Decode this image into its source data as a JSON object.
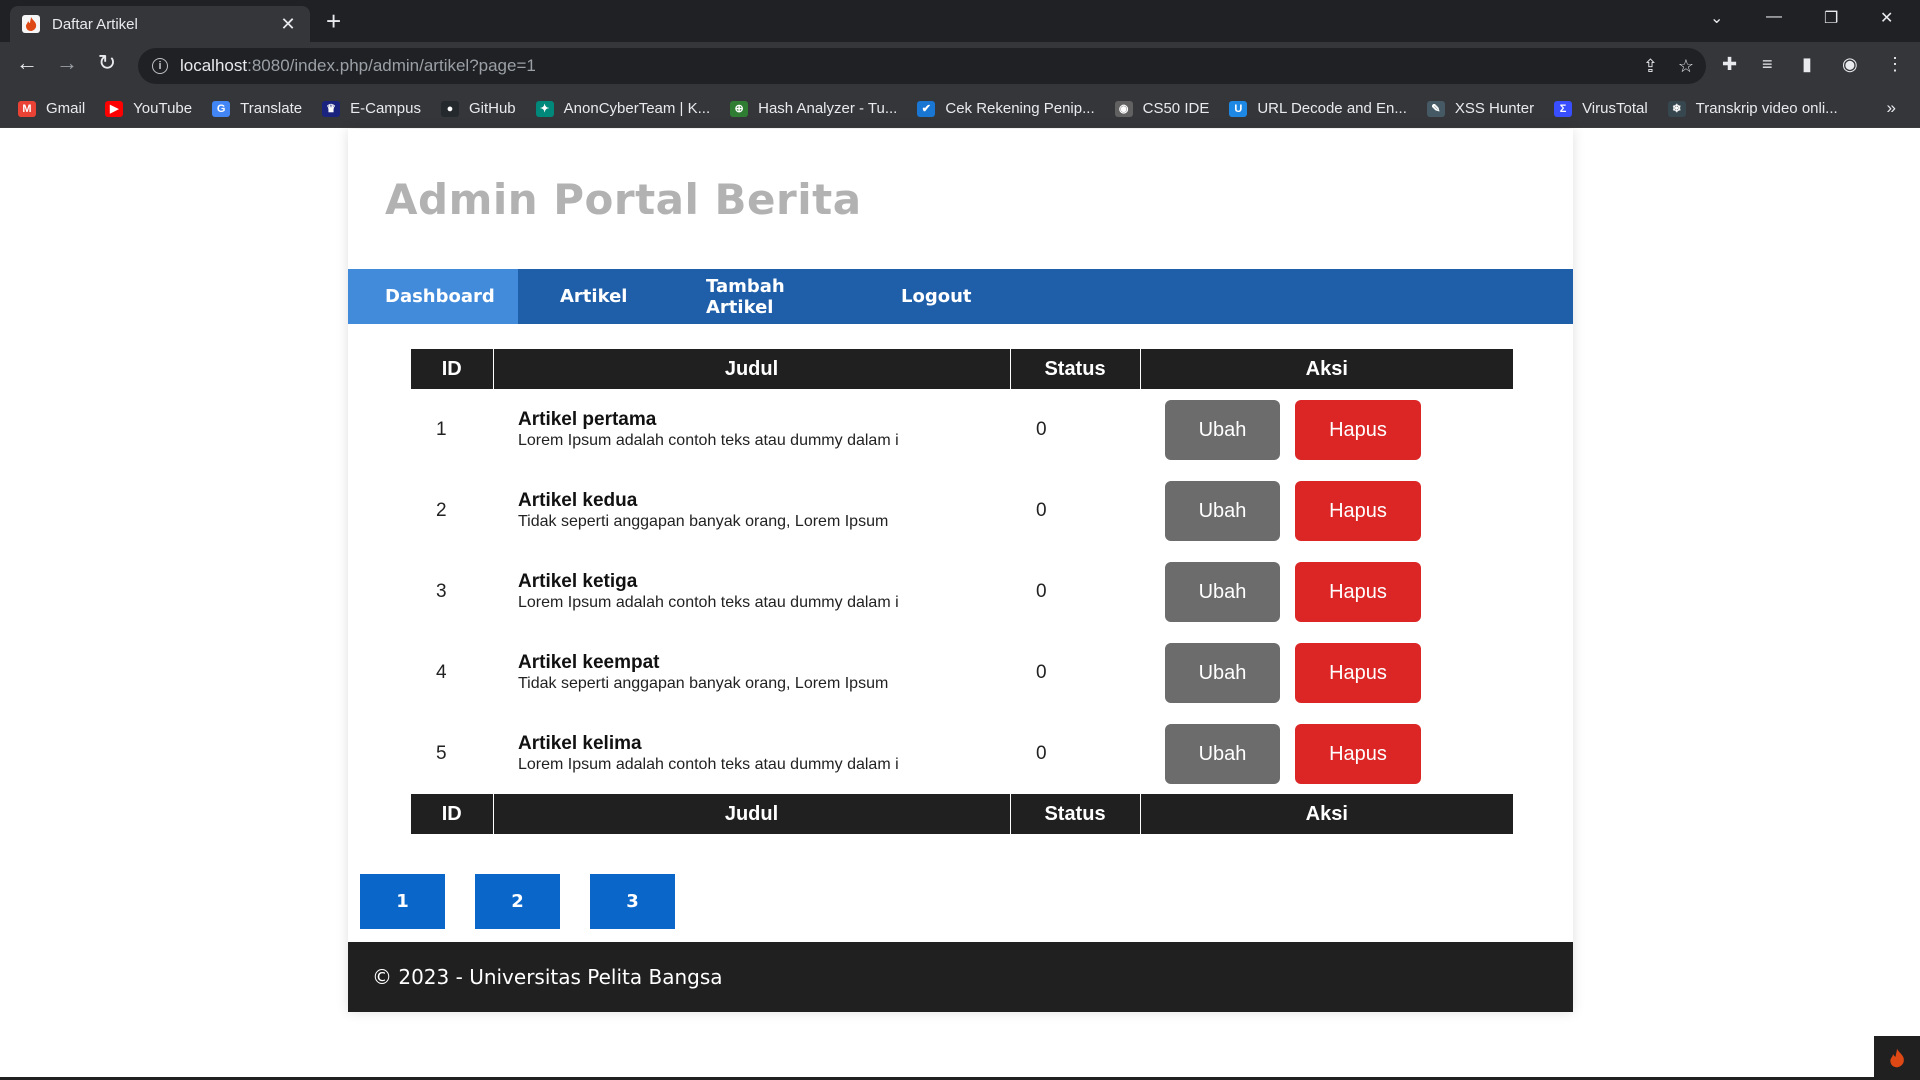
{
  "browser": {
    "tab_title": "Daftar Artikel",
    "url_host": "localhost",
    "url_rest": ":8080/index.php/admin/artikel?page=1",
    "bookmarks": [
      {
        "label": "Gmail",
        "icon": "gmail-icon",
        "color": "#ea4335",
        "glyph": "M"
      },
      {
        "label": "YouTube",
        "icon": "youtube-icon",
        "color": "#ff0000",
        "glyph": "▶"
      },
      {
        "label": "Translate",
        "icon": "translate-icon",
        "color": "#4285f4",
        "glyph": "G"
      },
      {
        "label": "E-Campus",
        "icon": "ecampus-icon",
        "color": "#1a237e",
        "glyph": "♛"
      },
      {
        "label": "GitHub",
        "icon": "github-icon",
        "color": "#24292e",
        "glyph": "●"
      },
      {
        "label": "AnonCyberTeam | K...",
        "icon": "anon-icon",
        "color": "#00897b",
        "glyph": "✦"
      },
      {
        "label": "Hash Analyzer - Tu...",
        "icon": "hash-icon",
        "color": "#2e7d32",
        "glyph": "⊕"
      },
      {
        "label": "Cek Rekening Penip...",
        "icon": "check-icon",
        "color": "#1976d2",
        "glyph": "✔"
      },
      {
        "label": "CS50 IDE",
        "icon": "cs50-icon",
        "color": "#616161",
        "glyph": "◉"
      },
      {
        "label": "URL Decode and En...",
        "icon": "url-icon",
        "color": "#1e88e5",
        "glyph": "U"
      },
      {
        "label": "XSS Hunter",
        "icon": "xss-icon",
        "color": "#455a64",
        "glyph": "✎"
      },
      {
        "label": "VirusTotal",
        "icon": "virustotal-icon",
        "color": "#394eff",
        "glyph": "Σ"
      },
      {
        "label": "Transkrip video onli...",
        "icon": "transkrip-icon",
        "color": "#37474f",
        "glyph": "❄"
      }
    ]
  },
  "page": {
    "site_title": "Admin Portal Berita",
    "nav": {
      "dashboard": "Dashboard",
      "artikel": "Artikel",
      "tambah": "Tambah Artikel",
      "logout": "Logout"
    },
    "table": {
      "headers": {
        "id": "ID",
        "judul": "Judul",
        "status": "Status",
        "aksi": "Aksi"
      },
      "rows": [
        {
          "id": "1",
          "title": "Artikel pertama",
          "desc": "Lorem Ipsum adalah contoh teks atau dummy dalam i",
          "status": "0",
          "ubah": "Ubah",
          "hapus": "Hapus"
        },
        {
          "id": "2",
          "title": "Artikel kedua",
          "desc": "Tidak seperti anggapan banyak orang, Lorem Ipsum",
          "status": "0",
          "ubah": "Ubah",
          "hapus": "Hapus"
        },
        {
          "id": "3",
          "title": "Artikel ketiga",
          "desc": "Lorem Ipsum adalah contoh teks atau dummy dalam i",
          "status": "0",
          "ubah": "Ubah",
          "hapus": "Hapus"
        },
        {
          "id": "4",
          "title": "Artikel keempat",
          "desc": "Tidak seperti anggapan banyak orang, Lorem Ipsum",
          "status": "0",
          "ubah": "Ubah",
          "hapus": "Hapus"
        },
        {
          "id": "5",
          "title": "Artikel kelima",
          "desc": "Lorem Ipsum adalah contoh teks atau dummy dalam i",
          "status": "0",
          "ubah": "Ubah",
          "hapus": "Hapus"
        }
      ]
    },
    "pagination": [
      "1",
      "2",
      "3"
    ],
    "footer": "© 2023 - Universitas Pelita Bangsa"
  },
  "colors": {
    "navbar": "#1f5faa",
    "nav_active": "#428bdb",
    "table_header": "#202020",
    "ubah": "#6c6c6c",
    "hapus": "#dc2626",
    "pager": "#0a66c9"
  }
}
